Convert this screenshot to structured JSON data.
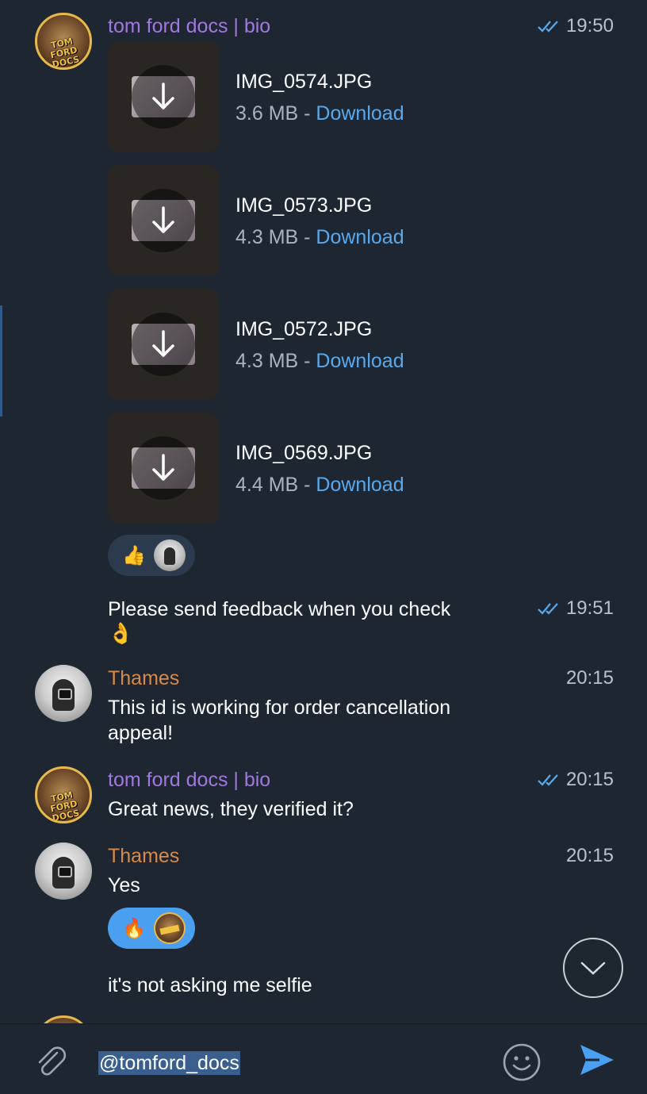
{
  "messages": [
    {
      "sender": "tom ford docs | bio",
      "time": "19:50",
      "files": [
        {
          "name": "IMG_0574.JPG",
          "size": "3.6 MB",
          "sep": " - ",
          "action": "Download"
        },
        {
          "name": "IMG_0573.JPG",
          "size": "4.3 MB",
          "sep": " - ",
          "action": "Download"
        },
        {
          "name": "IMG_0572.JPG",
          "size": "4.3 MB",
          "sep": " - ",
          "action": "Download"
        },
        {
          "name": "IMG_0569.JPG",
          "size": "4.4 MB",
          "sep": " - ",
          "action": "Download"
        }
      ],
      "reaction": {
        "emoji": "👍"
      }
    },
    {
      "text": "Please send feedback when you check",
      "emoji": "👌",
      "time": "19:51"
    },
    {
      "sender": "Thames",
      "time": "20:15",
      "text_line1": "This id is working for order cancellation",
      "text_line2": "appeal!"
    },
    {
      "sender": "tom ford docs | bio",
      "time": "20:15",
      "text": "Great news, they verified it?"
    },
    {
      "sender": "Thames",
      "time": "20:15",
      "text": "Yes",
      "reaction": {
        "emoji": "🔥"
      }
    },
    {
      "text": "it's not asking me selfie"
    }
  ],
  "avatar_logo": "TOM FORD DOCS",
  "input": {
    "value": "@tomford_docs"
  },
  "icons": {
    "attach": "paperclip-icon",
    "emoji": "smiley-icon",
    "send": "send-icon",
    "scroll": "chevron-down-icon",
    "read": "double-check-icon"
  },
  "colors": {
    "background": "#1e2631",
    "accent": "#5aa9ee",
    "sender_tomford": "#a078e0",
    "sender_thames": "#d88a48",
    "reaction_active": "#4a9ff0"
  }
}
